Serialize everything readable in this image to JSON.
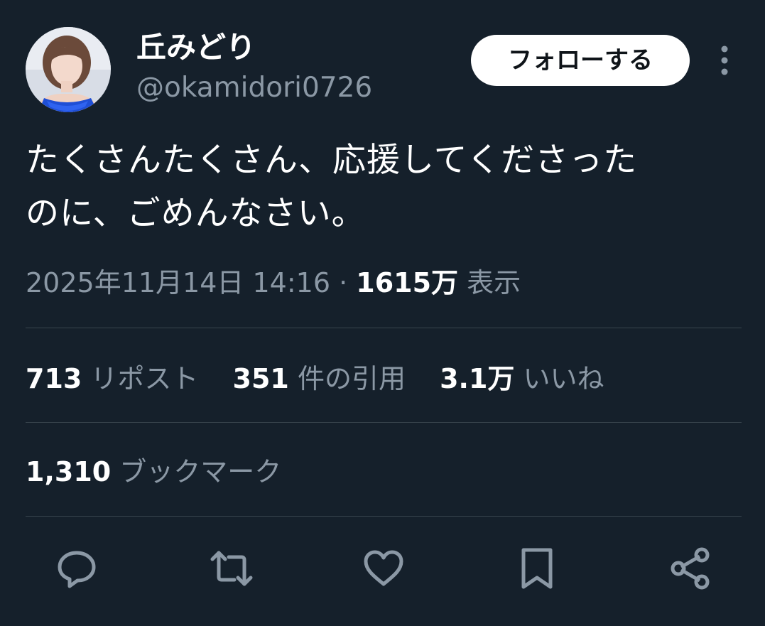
{
  "user": {
    "display_name": "丘みどり",
    "handle": "@okamidori0726"
  },
  "follow_button": {
    "label": "フォローする"
  },
  "tweet": {
    "text_lines": [
      "たくさんたくさん、応援してくださった",
      "のに、ごめんなさい。"
    ]
  },
  "meta": {
    "datetime": "2025年11月14日 14:16",
    "separator": "·",
    "views_count": "1615万",
    "views_label": "表示"
  },
  "stats": {
    "reposts": {
      "count": "713",
      "label": "リポスト"
    },
    "quotes": {
      "count": "351",
      "label": "件の引用"
    },
    "likes": {
      "count": "3.1万",
      "label": "いいね"
    },
    "bookmarks": {
      "count": "1,310",
      "label": "ブックマーク"
    }
  },
  "icons": {
    "more": "more-vertical-icon",
    "reply": "reply-icon",
    "repost": "repost-icon",
    "like": "heart-icon",
    "bookmark": "bookmark-icon",
    "share": "share-icon"
  },
  "colors": {
    "background": "#15202b",
    "text_primary": "#ffffff",
    "text_secondary": "#8b98a5",
    "divider": "#38444d",
    "follow_button_bg": "#ffffff",
    "follow_button_text": "#0f1419",
    "avatar_dress": "#1f4fd6"
  }
}
